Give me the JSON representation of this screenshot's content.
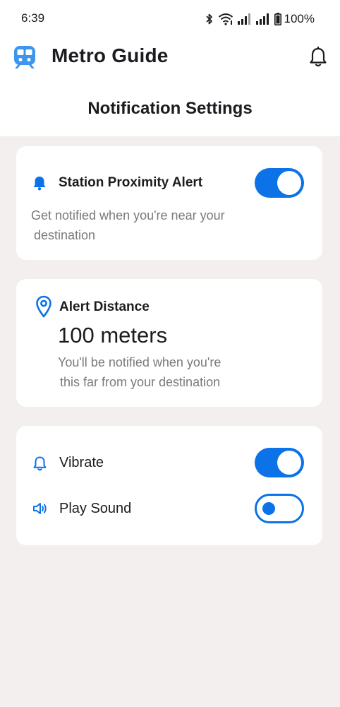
{
  "status_bar": {
    "time": "6:39",
    "battery": "100%"
  },
  "app_bar": {
    "title": "Metro Guide"
  },
  "page": {
    "title": "Notification Settings"
  },
  "proximity_alert": {
    "title": "Station Proximity Alert",
    "description_line1": "Get notified when you're near your",
    "description_line2": "destination",
    "enabled": true
  },
  "alert_distance": {
    "title": "Alert Distance",
    "value": "100 meters",
    "description_line1": "You'll be notified when you're",
    "description_line2": "this far from your destination"
  },
  "preferences": {
    "vibrate": {
      "label": "Vibrate",
      "enabled": true
    },
    "play_sound": {
      "label": "Play Sound",
      "enabled": false
    }
  },
  "colors": {
    "accent": "#0b72e7",
    "background": "#f2efee",
    "card": "#ffffff",
    "secondary_text": "#7a7a7a"
  },
  "icons": {
    "logo": "metro-train-icon",
    "app_bar_action": "bell-outline-icon",
    "proximity": "bell-filled-icon",
    "distance": "location-pin-icon",
    "vibrate": "bell-outline-icon",
    "sound": "speaker-icon"
  }
}
